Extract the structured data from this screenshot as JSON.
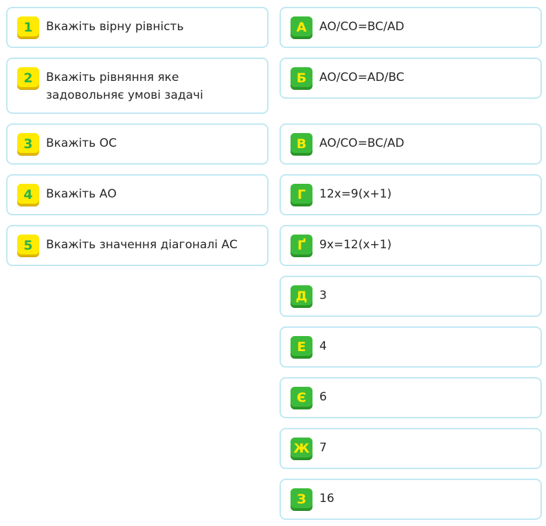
{
  "questions": [
    {
      "num": "1",
      "text": "Вкажіть вірну рівність"
    },
    {
      "num": "2",
      "text": "Вкажіть рівняння яке задовольняє умові задачі"
    },
    {
      "num": "3",
      "text": "Вкажіть ОС"
    },
    {
      "num": "4",
      "text": "Вкажіть АО"
    },
    {
      "num": "5",
      "text": "Вкажіть значення діагоналі АС"
    }
  ],
  "answers": [
    {
      "letter": "А",
      "text": "AO/CO=BC/AD"
    },
    {
      "letter": "Б",
      "text": "AO/CO=AD/BC"
    },
    {
      "letter": "В",
      "text": "AO/CO=BC/AD"
    },
    {
      "letter": "Г",
      "text": "12x=9(x+1)"
    },
    {
      "letter": "Ґ",
      "text": "9x=12(x+1)"
    },
    {
      "letter": "Д",
      "text": "3"
    },
    {
      "letter": "Е",
      "text": "4"
    },
    {
      "letter": "Є",
      "text": "6"
    },
    {
      "letter": "Ж",
      "text": "7"
    },
    {
      "letter": "З",
      "text": "16"
    }
  ],
  "colors": {
    "card_border": "#bfe8f3",
    "number_badge": "#ffea00",
    "number_badge_text": "#29b24a",
    "letter_badge": "#3cbb3a",
    "letter_badge_text": "#ffea00",
    "text": "#262626"
  }
}
